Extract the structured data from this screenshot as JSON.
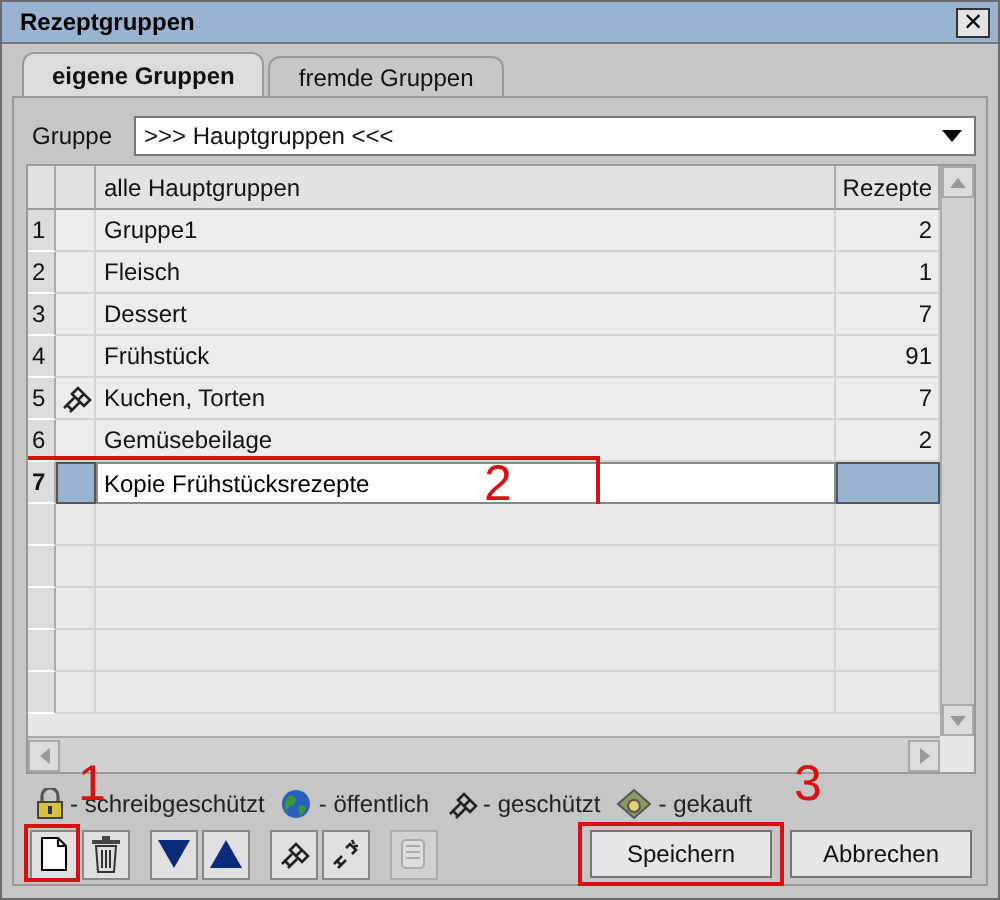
{
  "window": {
    "title": "Rezeptgruppen",
    "close": "×"
  },
  "tabs": [
    {
      "label": "eigene Gruppen",
      "selected": true
    },
    {
      "label": "fremde Gruppen",
      "selected": false
    }
  ],
  "group_selector": {
    "label": "Gruppe",
    "value": ">>> Hauptgruppen <<<"
  },
  "table": {
    "columns": [
      "alle Hauptgruppen",
      "Rezepte"
    ],
    "rows": [
      {
        "number": "1",
        "name": "Gruppe1",
        "count": "2",
        "selected": false
      },
      {
        "number": "2",
        "name": "Fleisch",
        "count": "1",
        "selected": false
      },
      {
        "number": "3",
        "name": "Dessert",
        "count": "7",
        "selected": false
      },
      {
        "number": "4",
        "name": "Frühstück",
        "count": "91",
        "selected": false
      },
      {
        "number": "5",
        "kind": "protected",
        "name": "Kuchen, Torten",
        "count": "7",
        "selected": false
      },
      {
        "number": "6",
        "name": "Gemüsebeilage",
        "count": "2",
        "selected": false
      },
      {
        "number": "7",
        "name": "Kopie Frühstücksrezepte",
        "selected": true,
        "annotation": "2"
      }
    ]
  },
  "legend": [
    {
      "kind": "lock",
      "label": "- schreibgeschützt"
    },
    {
      "kind": "globe",
      "label": "- öffentlich"
    },
    {
      "kind": "protected",
      "label": "- geschützt"
    },
    {
      "kind": "bought",
      "label": "- gekauft"
    }
  ],
  "toolbar": [
    {
      "kind": "new",
      "disabled": false,
      "annotation": "1"
    },
    {
      "kind": "delete",
      "disabled": false
    },
    {
      "kind": "down",
      "disabled": false
    },
    {
      "kind": "up",
      "disabled": false
    },
    {
      "kind": "protect",
      "disabled": false
    },
    {
      "kind": "unprotect",
      "disabled": false
    },
    {
      "kind": "copy",
      "disabled": true
    }
  ],
  "buttons": [
    {
      "label": "Speichern",
      "annotation": "3"
    },
    {
      "label": "Abbrechen"
    }
  ]
}
